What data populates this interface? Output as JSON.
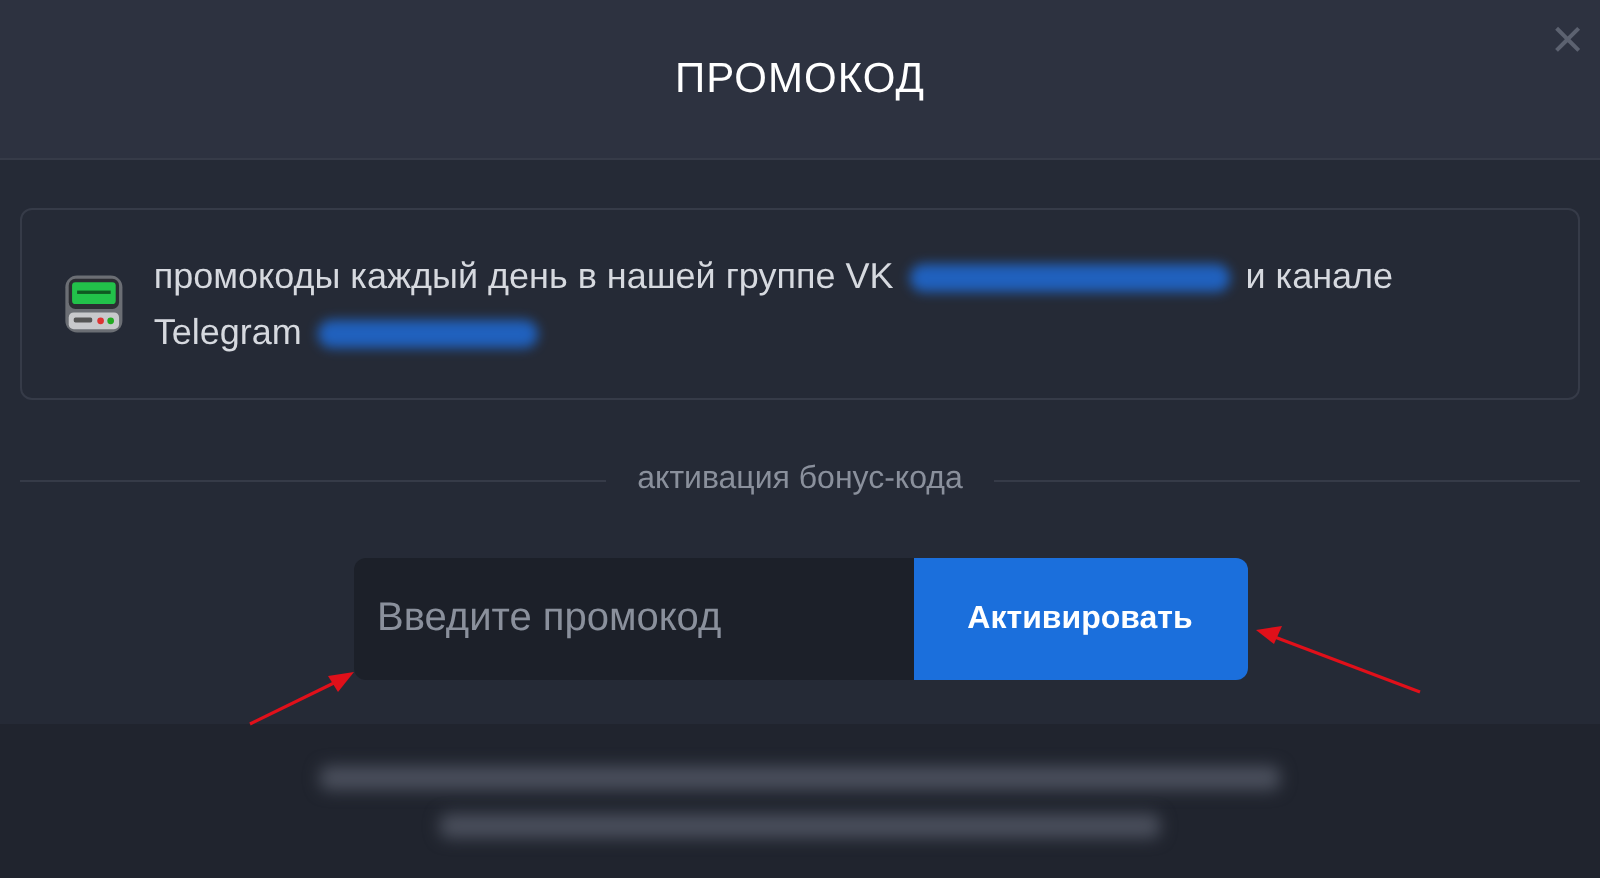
{
  "dialog": {
    "title": "ПРОМОКОД",
    "close": "×"
  },
  "notice": {
    "parts": [
      "промокоды каждый день в нашей группе VK",
      "и канале Telegram"
    ]
  },
  "section_label": "активация бонус-кода",
  "promo_field": {
    "placeholder": "Введите промокод"
  },
  "activate_button": "Активировать"
}
